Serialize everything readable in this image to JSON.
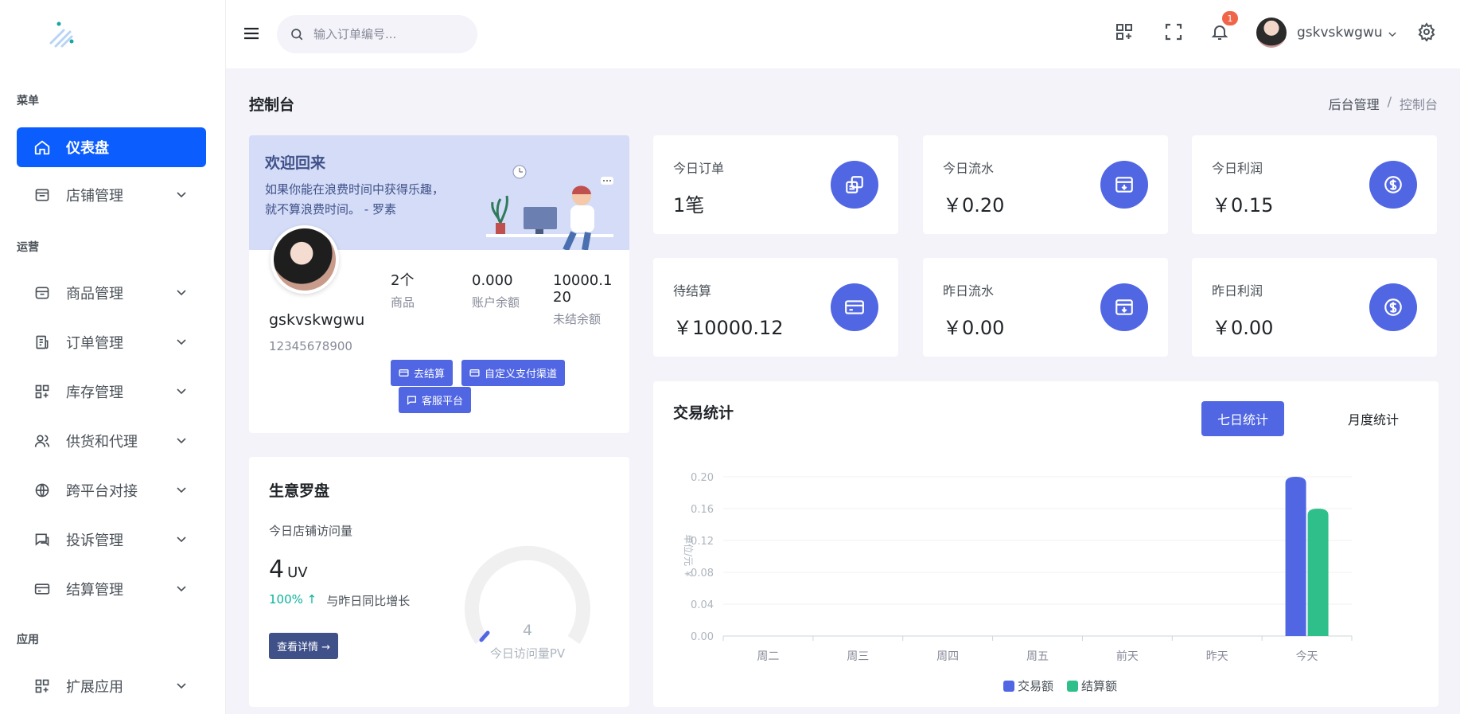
{
  "sidebar": {
    "sections": [
      "菜单",
      "运营",
      "应用"
    ],
    "items": [
      {
        "label": "仪表盘",
        "icon": "home-icon"
      },
      {
        "label": "店铺管理",
        "icon": "store-icon"
      },
      {
        "label": "商品管理",
        "icon": "box-icon"
      },
      {
        "label": "订单管理",
        "icon": "order-icon"
      },
      {
        "label": "库存管理",
        "icon": "grid-plus-icon"
      },
      {
        "label": "供货和代理",
        "icon": "users-icon"
      },
      {
        "label": "跨平台对接",
        "icon": "globe-icon"
      },
      {
        "label": "投诉管理",
        "icon": "chat-icon"
      },
      {
        "label": "结算管理",
        "icon": "card-icon"
      },
      {
        "label": "扩展应用",
        "icon": "grid-plus-icon"
      }
    ]
  },
  "header": {
    "search_placeholder": "输入订单编号...",
    "notification_count": "1",
    "username": "gskvskwgwu"
  },
  "page": {
    "title": "控制台",
    "breadcrumb": [
      "后台管理",
      "/",
      "控制台"
    ]
  },
  "welcome": {
    "title": "欢迎回来",
    "quote": "如果你能在浪费时间中获得乐趣，就不算浪费时间。 - 罗素",
    "name": "gskvskwgwu",
    "phone": "12345678900",
    "stats": [
      {
        "value": "2个",
        "label": "商品"
      },
      {
        "value": "0.000",
        "label": "账户余额"
      },
      {
        "value": "10000.120",
        "label": "未结余额"
      }
    ],
    "buttons": [
      "去结算",
      "自定义支付渠道",
      "客服平台"
    ]
  },
  "stat_cards": [
    {
      "title": "今日订单",
      "value": "1笔"
    },
    {
      "title": "今日流水",
      "value": "￥0.20"
    },
    {
      "title": "今日利润",
      "value": "￥0.15"
    },
    {
      "title": "待结算",
      "value": "￥10000.12"
    },
    {
      "title": "昨日流水",
      "value": "￥0.00"
    },
    {
      "title": "昨日利润",
      "value": "￥0.00"
    }
  ],
  "compass": {
    "title": "生意罗盘",
    "subtitle": "今日店铺访问量",
    "uv_value": "4",
    "uv_unit": "UV",
    "growth_pct": "100% ↑",
    "growth_text": "与昨日同比增长",
    "detail_button": "查看详情 →",
    "gauge_value": "4",
    "gauge_label": "今日访问量PV"
  },
  "trade": {
    "title": "交易统计",
    "tab_active": "七日统计",
    "tab_inactive": "月度统计"
  },
  "colors": {
    "primary": "#5066e3",
    "active_nav": "#0c5dfe",
    "series_trade": "#5066e3",
    "series_settle": "#2fbf8a"
  },
  "chart_data": {
    "type": "bar",
    "categories": [
      "周二",
      "周三",
      "周四",
      "周五",
      "前天",
      "昨天",
      "今天"
    ],
    "series": [
      {
        "name": "交易额",
        "values": [
          0,
          0,
          0,
          0,
          0,
          0,
          0.2
        ]
      },
      {
        "name": "结算额",
        "values": [
          0,
          0,
          0,
          0,
          0,
          0,
          0.16
        ]
      }
    ],
    "ylabel": "单位/元 ￥",
    "ylim": [
      0,
      0.2
    ],
    "yticks": [
      "0.00",
      "0.04",
      "0.08",
      "0.12",
      "0.16",
      "0.20"
    ],
    "legend": "bottom",
    "grid": true
  }
}
